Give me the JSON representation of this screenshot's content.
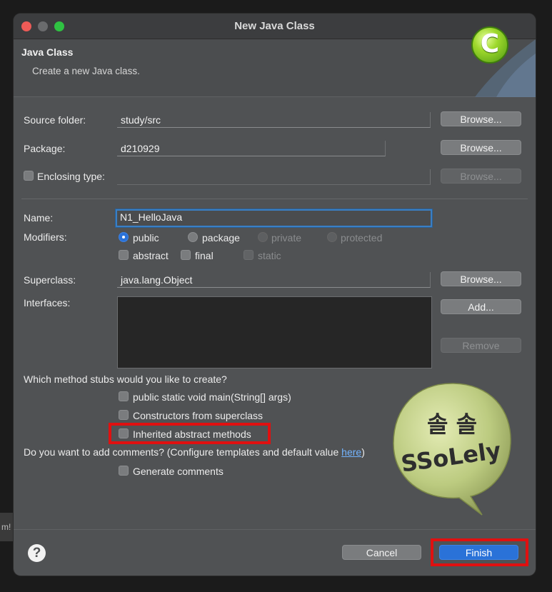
{
  "background_fragment": "m!",
  "window": {
    "title": "New Java Class",
    "controls": [
      "close-icon",
      "minimize-icon",
      "zoom-icon"
    ]
  },
  "header": {
    "title": "Java Class",
    "subtitle": "Create a new Java class.",
    "icon_letter": "C"
  },
  "source_folder": {
    "label": "Source folder:",
    "value": "study/src",
    "browse_label": "Browse..."
  },
  "package": {
    "label": "Package:",
    "value": "d210929",
    "browse_label": "Browse..."
  },
  "enclosing_type": {
    "label": "Enclosing type:",
    "value": "",
    "checked": false,
    "browse_label": "Browse..."
  },
  "name": {
    "label": "Name:",
    "value": "N1_HelloJava"
  },
  "modifiers": {
    "label": "Modifiers:",
    "access": [
      {
        "label": "public",
        "selected": true,
        "enabled": true
      },
      {
        "label": "package",
        "selected": false,
        "enabled": true
      },
      {
        "label": "private",
        "selected": false,
        "enabled": false
      },
      {
        "label": "protected",
        "selected": false,
        "enabled": false
      }
    ],
    "other": [
      {
        "label": "abstract",
        "checked": false,
        "enabled": true
      },
      {
        "label": "final",
        "checked": false,
        "enabled": true
      },
      {
        "label": "static",
        "checked": false,
        "enabled": false
      }
    ]
  },
  "superclass": {
    "label": "Superclass:",
    "value": "java.lang.Object",
    "browse_label": "Browse..."
  },
  "interfaces": {
    "label": "Interfaces:",
    "add_label": "Add...",
    "remove_label": "Remove",
    "items": []
  },
  "method_stubs": {
    "question": "Which method stubs would you like to create?",
    "options": [
      {
        "label": "public static void main(String[] args)",
        "checked": false
      },
      {
        "label": "Constructors from superclass",
        "checked": false
      },
      {
        "label": "Inherited abstract methods",
        "checked": false
      }
    ]
  },
  "comments": {
    "question_prefix": "Do you want to add comments? (Configure templates and default value ",
    "link_text": "here",
    "question_suffix": ")",
    "option": {
      "label": "Generate comments",
      "checked": false
    }
  },
  "sticker": {
    "line1": "솔 솔",
    "line2": "SSoLely",
    "color": "#c2cf86"
  },
  "footer": {
    "cancel_label": "Cancel",
    "finish_label": "Finish",
    "help_icon": "question-icon"
  },
  "colors": {
    "accent": "#2a72d8",
    "highlight": "#e01010"
  }
}
